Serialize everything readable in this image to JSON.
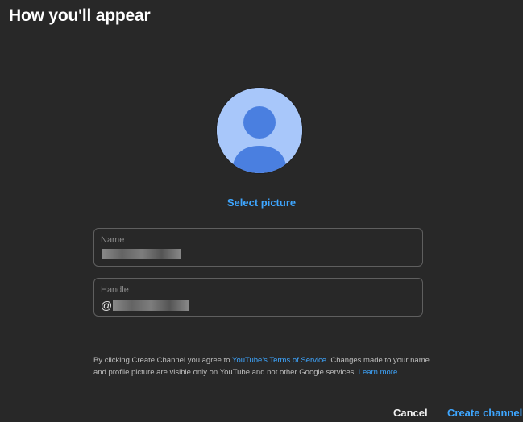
{
  "dialog": {
    "title": "How you'll appear"
  },
  "avatar": {
    "icon": "person-icon",
    "bg_color": "#a8c7fa",
    "fg_color": "#4a7fe0"
  },
  "select_picture_label": "Select picture",
  "fields": {
    "name": {
      "label": "Name",
      "value_redacted": true
    },
    "handle": {
      "label": "Handle",
      "prefix": "@",
      "value_redacted": true
    }
  },
  "disclaimer": {
    "text_1": "By clicking Create Channel you agree to ",
    "tos_link": "YouTube's Terms of Service",
    "text_2": ". Changes made to your name and profile picture are visible only on YouTube and not other Google services. ",
    "learn_more_link": "Learn more"
  },
  "buttons": {
    "cancel": "Cancel",
    "create": "Create channel"
  },
  "colors": {
    "background": "#282828",
    "accent": "#3ea6ff",
    "border": "#5f5f5f"
  }
}
